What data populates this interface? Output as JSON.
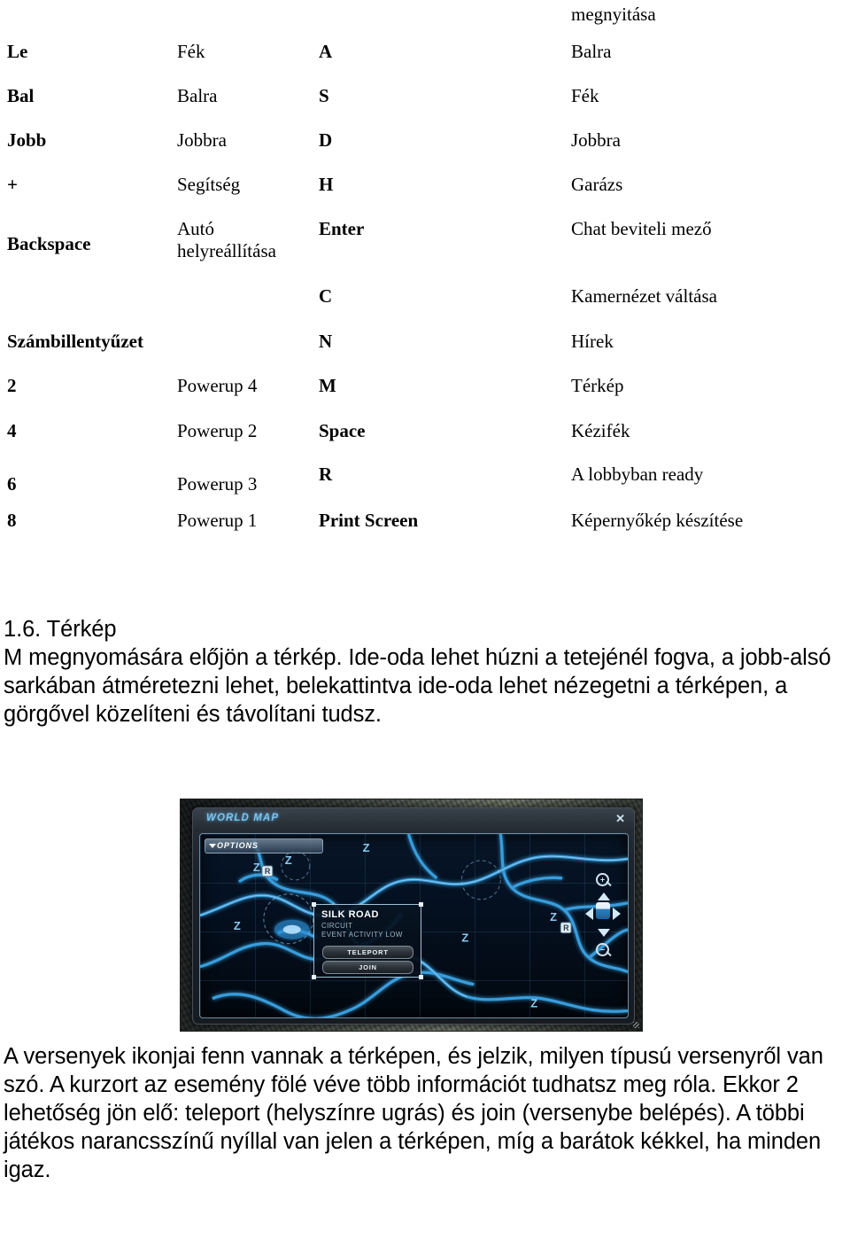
{
  "document": {
    "orphan_line": "megnyitása",
    "key_table": {
      "rows": [
        {
          "key_left": "Le",
          "action_left": "Fék",
          "key_right": "A",
          "action_right": "Balra"
        },
        {
          "key_left": "Bal",
          "action_left": "Balra",
          "key_right": "S",
          "action_right": "Fék"
        },
        {
          "key_left": "Jobb",
          "action_left": "Jobbra",
          "key_right": "D",
          "action_right": "Jobbra"
        },
        {
          "key_left": "+",
          "action_left": "Segítség",
          "key_right": "H",
          "action_right": "Garázs"
        },
        {
          "key_left": "Backspace",
          "action_left": "Autó\nhelyreállítása",
          "key_right": "Enter",
          "action_right": "Chat beviteli mező"
        },
        {
          "key_left": "",
          "action_left": "",
          "key_right": "C",
          "action_right": "Kamernézet váltása"
        },
        {
          "key_left": "Számbillentyűzet",
          "action_left": "",
          "key_right": "N",
          "action_right": "Hírek"
        },
        {
          "key_left": "2",
          "action_left": "Powerup 4",
          "key_right": "M",
          "action_right": "Térkép"
        },
        {
          "key_left": "4",
          "action_left": "Powerup 2",
          "key_right": "Space",
          "action_right": "Kézifék"
        },
        {
          "key_left": "6",
          "action_left": "Powerup 3",
          "key_right": "R",
          "action_right": "A lobbyban ready"
        },
        {
          "key_left": "8",
          "action_left": "Powerup 1",
          "key_right": "Print Screen",
          "action_right": "Képernyőkép készítése"
        }
      ]
    },
    "section": {
      "heading": "1.6. Térkép",
      "paragraph_map": "M megnyomására előjön a térkép. Ide-oda lehet húzni a tetejénél fogva, a jobb-alsó sarkában átméretezni lehet, belekattintva ide-oda lehet nézegetni a térképen, a görgővel közelíteni és távolítani tudsz.",
      "paragraph_events": "A versenyek ikonjai fenn vannak a térképen, és jelzik, milyen típusú versenyről van szó. A kurzort az esemény fölé véve több információt tudhatsz meg róla. Ekkor 2 lehetőség jön elő: teleport (helyszínre ugrás) és join (versenybe belépés). A többi játékos narancsszínű nyíllal van jelen a térképen, míg a barátok kékkel, ha minden igaz."
    }
  },
  "map_screenshot": {
    "window_title": "WORLD MAP",
    "close_label": "✕",
    "options_label": "OPTIONS",
    "event_popup": {
      "title": "SILK ROAD",
      "type": "CIRCUIT",
      "activity": "EVENT ACTIVITY LOW",
      "teleport_label": "TELEPORT",
      "join_label": "JOIN"
    },
    "nav": {
      "zoom_in": "+",
      "zoom_out": "−"
    },
    "colors": {
      "road": "#3aa6e8",
      "map_bg": "#041020",
      "title_accent": "#7cc4f0"
    }
  }
}
